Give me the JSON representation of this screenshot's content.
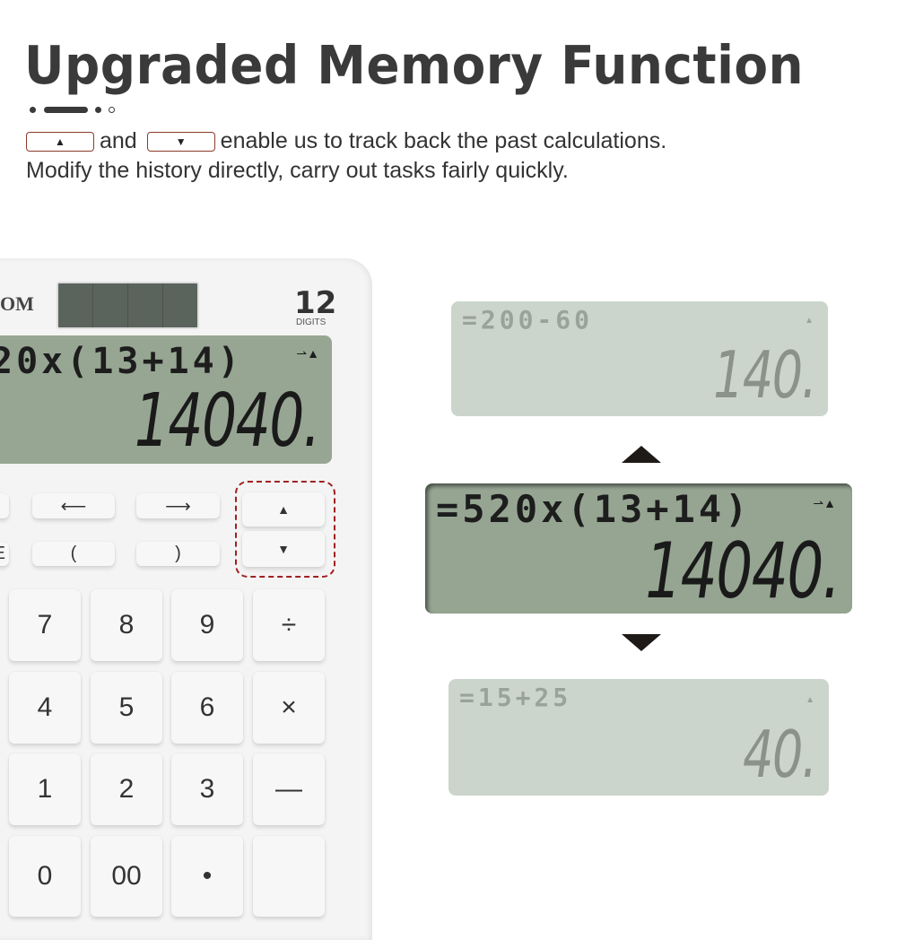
{
  "header": {
    "title": "Upgraded Memory Function",
    "line1_and": "and",
    "line1_rest": "enable us to track back the past calculations.",
    "line2": "Modify the history directly, carry out tasks fairly quickly.",
    "up_symbol": "▲",
    "down_symbol": "▼"
  },
  "calculator": {
    "brand": "OM",
    "digits_number": "12",
    "digits_label": "DIGITS",
    "display": {
      "expression": "20x(13+14)",
      "result": "14040.",
      "indicator": "⇀▲"
    },
    "function_keys": [
      {
        "label": "⟵"
      },
      {
        "label": "⟶"
      },
      {
        "label": "("
      },
      {
        "label": ")"
      },
      {
        "label": "E"
      }
    ],
    "history_keys": {
      "up": "▲",
      "down": "▼"
    },
    "number_keys": [
      [
        "7",
        "8",
        "9",
        "÷"
      ],
      [
        "4",
        "5",
        "6",
        "×"
      ],
      [
        "1",
        "2",
        "3",
        "—"
      ],
      [
        "0",
        "00",
        "•",
        ""
      ]
    ]
  },
  "history_displays": [
    {
      "expression": "=200-60",
      "result": "140.",
      "indicator": "▲",
      "state": "previous"
    },
    {
      "expression": "=520x(13+14)",
      "result": "14040.",
      "indicator": "⇀▲",
      "state": "current"
    },
    {
      "expression": "=15+25",
      "result": "40.",
      "indicator": "▲",
      "state": "next"
    }
  ],
  "arrows": {
    "up": "up-arrow",
    "down": "down-arrow"
  },
  "colors": {
    "lcd_active": "#95a592",
    "lcd_inactive": "#ccd5cc",
    "highlight": "#a02020",
    "text": "#333333"
  }
}
